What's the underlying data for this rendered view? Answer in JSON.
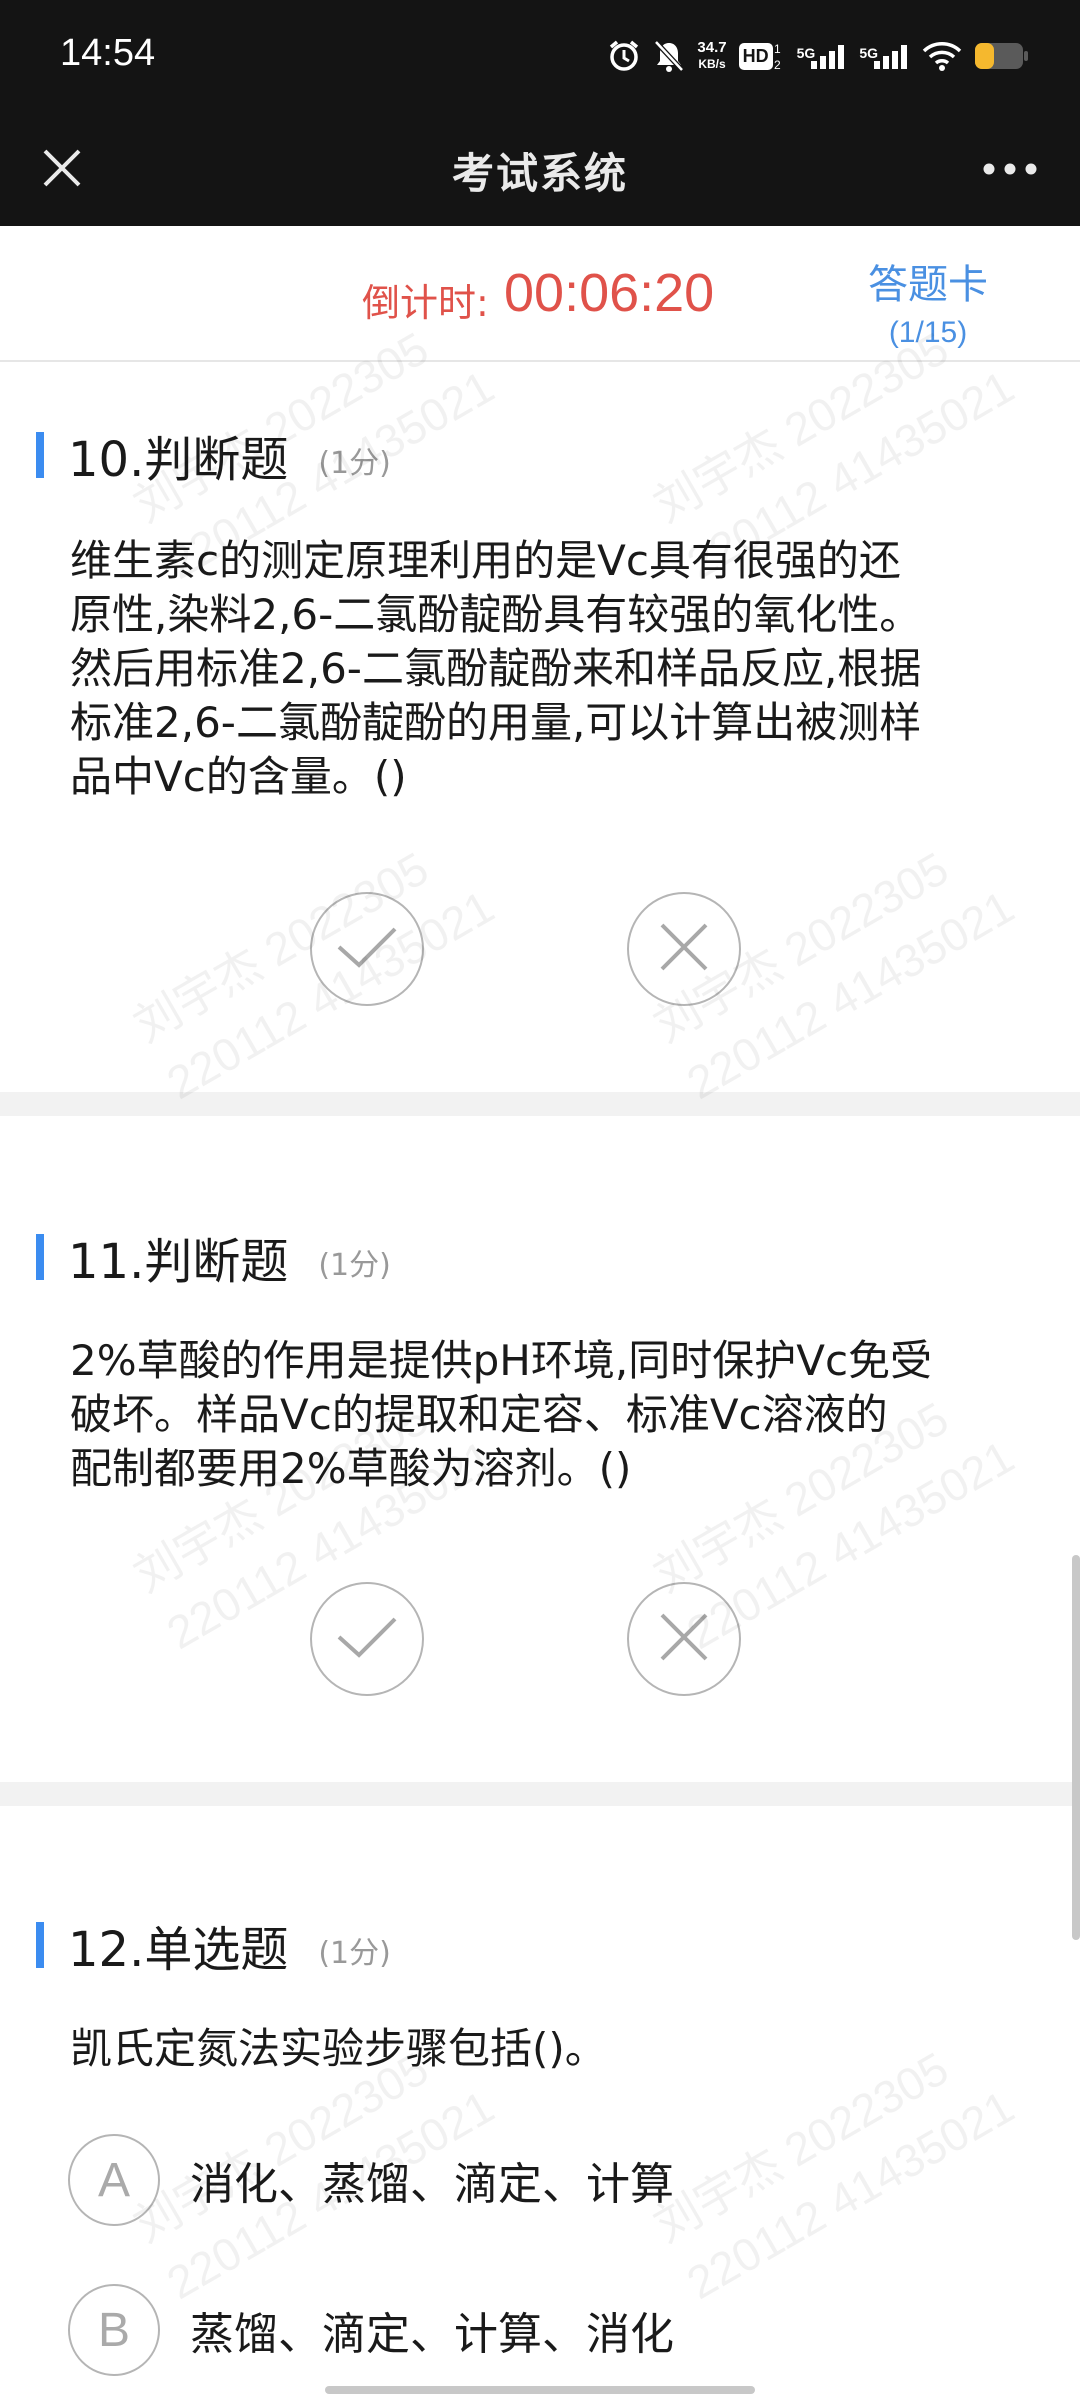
{
  "status_bar": {
    "time": "14:54",
    "net_speed_value": "34.7",
    "net_speed_unit": "KB/s",
    "hd_label": "HD",
    "sim_label_1": "5G",
    "sim_label_2": "5G",
    "battery_color": "#f5b82e"
  },
  "app_bar": {
    "title": "考试系统"
  },
  "timer": {
    "label": "倒计时:",
    "value": "00:06:20",
    "color": "#e0524a"
  },
  "answer_card": {
    "title": "答题卡",
    "progress": "(1/15)"
  },
  "watermark": {
    "line1": "刘宇杰 2022305",
    "line2": "220112 41435021"
  },
  "questions": [
    {
      "title": "10.判断题",
      "score": "(1分)",
      "lines": [
        "维生素c的测定原理利用的是Vc具有很强的还",
        "原性,染料2,6-二氯酚靛酚具有较强的氧化性。",
        "然后用标准2,6-二氯酚靛酚来和样品反应,根据",
        "标准2,6-二氯酚靛酚的用量,可以计算出被测样",
        "品中Vc的含量。()"
      ]
    },
    {
      "title": "11.判断题",
      "score": "(1分)",
      "lines": [
        "2%草酸的作用是提供pH环境,同时保护Vc免受",
        "破坏。样品Vc的提取和定容、标准Vc溶液的",
        "配制都要用2%草酸为溶剂。()"
      ]
    },
    {
      "title": "12.单选题",
      "score": "(1分)",
      "lines": [
        "凯氏定氮法实验步骤包括()。"
      ],
      "options": [
        {
          "letter": "A",
          "text": "消化、蒸馏、滴定、计算"
        },
        {
          "letter": "B",
          "text": "蒸馏、滴定、计算、消化"
        }
      ]
    }
  ],
  "icons": {
    "close": "close-icon",
    "more": "more-icon",
    "true": "check-icon",
    "false": "cross-icon"
  }
}
